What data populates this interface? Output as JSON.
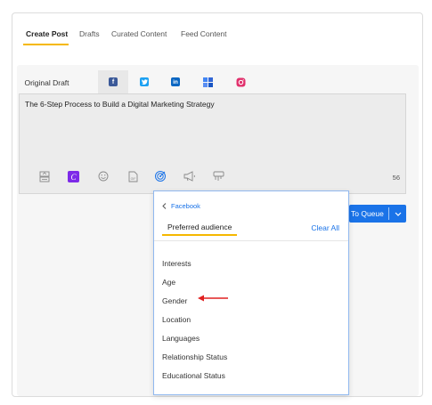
{
  "top_tabs": [
    {
      "label": "Create Post"
    },
    {
      "label": "Drafts"
    },
    {
      "label": "Curated Content"
    },
    {
      "label": "Feed Content"
    }
  ],
  "network_tabs": {
    "original_label": "Original Draft",
    "icons": [
      "facebook-icon",
      "twitter-icon",
      "linkedin-icon",
      "google-business-icon",
      "instagram-icon"
    ]
  },
  "editor": {
    "text": "The 6-Step Process to Build a Digital Marketing Strategy",
    "char_count": "56",
    "toolbar_icons": [
      "media-upload-icon",
      "canva-icon",
      "emoji-icon",
      "gif-icon",
      "targeting-icon",
      "megaphone-icon",
      "hashtag-icon"
    ]
  },
  "queue_button": {
    "label": "To Queue"
  },
  "dropdown": {
    "back_label": "Facebook",
    "title": "Preferred audience",
    "clear_label": "Clear All",
    "items": [
      "Interests",
      "Age",
      "Gender",
      "Location",
      "Languages",
      "Relationship Status",
      "Educational Status"
    ]
  },
  "colors": {
    "accent_blue": "#1a73e8",
    "accent_yellow": "#f5b800",
    "facebook": "#3b5998",
    "twitter": "#1da1f2",
    "linkedin": "#0a66c2",
    "instagram": "#e1306c",
    "annotation_arrow": "#e02020"
  }
}
